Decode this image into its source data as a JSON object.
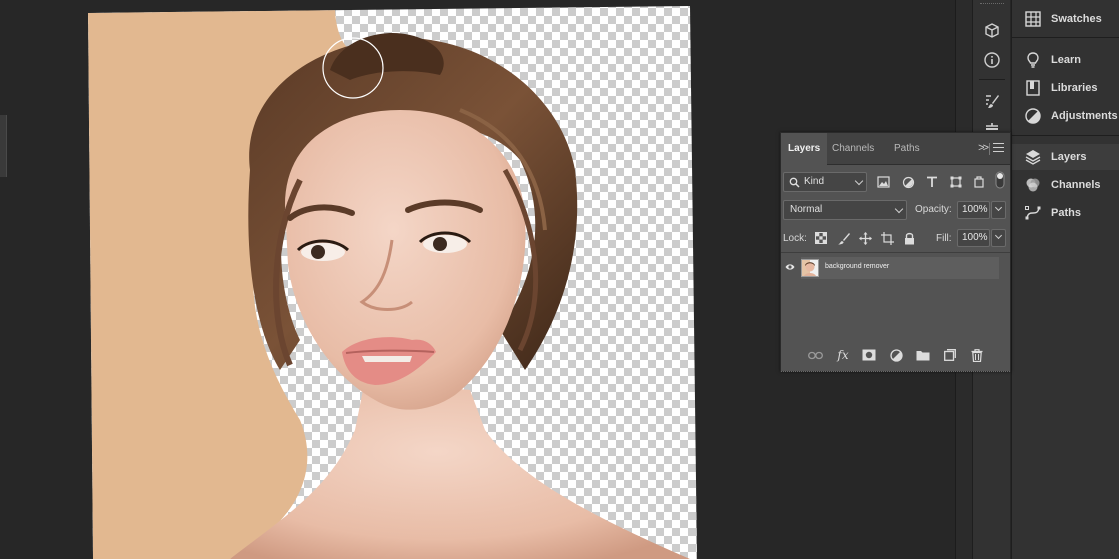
{
  "document": {
    "subject": "portrait",
    "cursor": "brush-circle",
    "colors": {
      "backdrop": "#e2b890",
      "workspace": "#272727",
      "checker_light": "#ffffff",
      "checker_dark": "#cccccc"
    }
  },
  "panel_list": {
    "items": [
      {
        "label": "Swatches",
        "icon": "swatches-icon"
      },
      {
        "label": "Learn",
        "icon": "bulb-icon"
      },
      {
        "label": "Libraries",
        "icon": "libraries-icon"
      },
      {
        "label": "Adjustments",
        "icon": "adjustments-icon"
      },
      {
        "label": "Layers",
        "icon": "layers-icon",
        "active": true
      },
      {
        "label": "Channels",
        "icon": "channels-icon"
      },
      {
        "label": "Paths",
        "icon": "paths-icon"
      }
    ]
  },
  "icon_strip": {
    "icons": [
      "3d-cube-icon",
      "info-icon",
      "brush-settings-icon",
      "tool-presets-icon"
    ]
  },
  "layers_panel": {
    "tabs": [
      {
        "label": "Layers",
        "active": true
      },
      {
        "label": "Channels"
      },
      {
        "label": "Paths"
      }
    ],
    "more_label": ">>",
    "filter": {
      "kind_label": "Kind"
    },
    "blend_mode": "Normal",
    "opacity_label": "Opacity:",
    "opacity_value": "100%",
    "lock_label": "Lock:",
    "fill_label": "Fill:",
    "fill_value": "100%",
    "layers": [
      {
        "name": "background remover",
        "visible": true
      }
    ],
    "footer_fx": "fx"
  }
}
